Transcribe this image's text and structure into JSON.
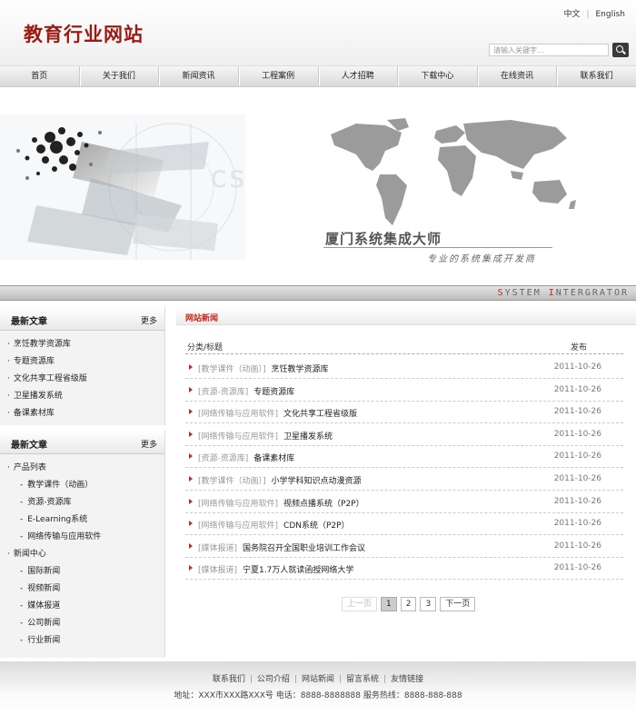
{
  "header": {
    "logo": "教育行业网站",
    "lang_zh": "中文",
    "lang_sep": "|",
    "lang_en": "English",
    "search_placeholder": "请输入关键字..."
  },
  "nav": [
    "首页",
    "关于我们",
    "新闻资讯",
    "工程案例",
    "人才招聘",
    "下载中心",
    "在线资讯",
    "联系我们"
  ],
  "banner": {
    "slogan_main": "厦门系统集成大师",
    "slogan_sub": "专业的系统集成开发商",
    "bar_text_1": "S",
    "bar_text_2": "YSTEM ",
    "bar_text_3": "I",
    "bar_text_4": "NTERGRATOR"
  },
  "sidebar": {
    "box1": {
      "title": "最新文章",
      "more": "更多",
      "items": [
        "烹饪教学资源库",
        "专题资源库",
        "文化共享工程省级版",
        "卫星播发系统",
        "备课素材库"
      ]
    },
    "box2": {
      "title": "最新文章",
      "more": "更多",
      "items": [
        {
          "label": "产品列表",
          "sub": false
        },
        {
          "label": "教学课件（动画）",
          "sub": true
        },
        {
          "label": "资源-资源库",
          "sub": true
        },
        {
          "label": "E-Learning系统",
          "sub": true
        },
        {
          "label": "网络传输与应用软件",
          "sub": true
        },
        {
          "label": "新闻中心",
          "sub": false
        },
        {
          "label": "国际新闻",
          "sub": true
        },
        {
          "label": "视频新闻",
          "sub": true
        },
        {
          "label": "媒体报道",
          "sub": true
        },
        {
          "label": "公司新闻",
          "sub": true
        },
        {
          "label": "行业新闻",
          "sub": true
        }
      ]
    }
  },
  "main": {
    "title": "网站新闻",
    "col_category": "分类/标题",
    "col_date": "发布",
    "news": [
      {
        "cat": "[教学课件（动画）]",
        "title": "烹饪教学资源库",
        "date": "2011-10-26"
      },
      {
        "cat": "[资源-资源库]",
        "title": "专题资源库",
        "date": "2011-10-26"
      },
      {
        "cat": "[网络传输与应用软件]",
        "title": "文化共享工程省级版",
        "date": "2011-10-26"
      },
      {
        "cat": "[网络传输与应用软件]",
        "title": "卫星播发系统",
        "date": "2011-10-26"
      },
      {
        "cat": "[资源-资源库]",
        "title": "备课素材库",
        "date": "2011-10-26"
      },
      {
        "cat": "[教学课件（动画）]",
        "title": "小学学科知识点动漫资源",
        "date": "2011-10-26"
      },
      {
        "cat": "[网络传输与应用软件]",
        "title": "视频点播系统（P2P）",
        "date": "2011-10-26"
      },
      {
        "cat": "[网络传输与应用软件]",
        "title": "CDN系统（P2P）",
        "date": "2011-10-26"
      },
      {
        "cat": "[媒体报道]",
        "title": "国务院召开全国职业培训工作会议",
        "date": "2011-10-26"
      },
      {
        "cat": "[媒体报道]",
        "title": "宁夏1.7万人就读函授网络大学",
        "date": "2011-10-26"
      }
    ],
    "pager": {
      "prev": "上一页",
      "pages": [
        "1",
        "2",
        "3"
      ],
      "next": "下一页"
    }
  },
  "footer": {
    "links": [
      "联系我们",
      "公司介绍",
      "网站新闻",
      "留言系统",
      "友情链接"
    ],
    "address": "地址：XXX市XXX路XXX号 电话：8888-8888888 服务热线：8888-888-888"
  },
  "colors": {
    "brand": "#9a1a14",
    "accent": "#c8261c"
  }
}
